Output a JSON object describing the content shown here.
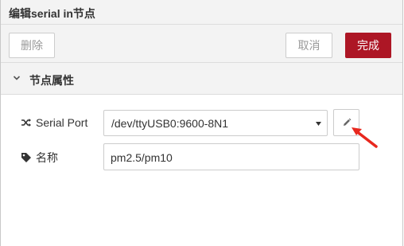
{
  "header": {
    "title": "编辑serial in节点"
  },
  "toolbar": {
    "delete_label": "删除",
    "cancel_label": "取消",
    "done_label": "完成"
  },
  "section": {
    "title": "节点属性"
  },
  "form": {
    "serial_port": {
      "label": "Serial Port",
      "value": "/dev/ttyUSB0:9600-8N1"
    },
    "name": {
      "label": "名称",
      "value": "pm2.5/pm10"
    }
  },
  "colors": {
    "accent": "#ad1625",
    "annotation_arrow": "#e8281e",
    "panel_bg": "#f3f3f3"
  },
  "icons": [
    "shuffle-icon",
    "tag-icon",
    "pencil-icon",
    "caret-down-icon",
    "select-arrow-icon"
  ]
}
